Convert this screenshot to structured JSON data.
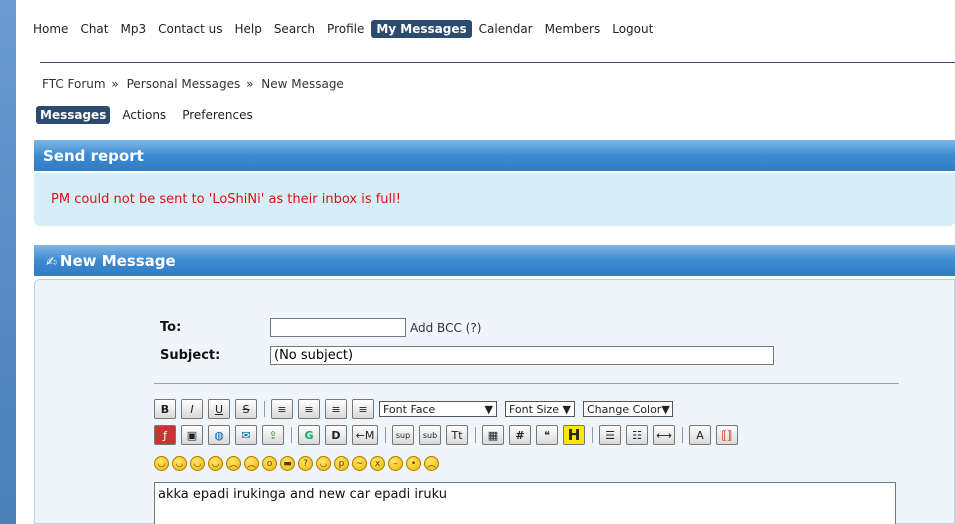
{
  "nav": [
    "Home",
    "Chat",
    "Mp3",
    "Contact us",
    "Help",
    "Search",
    "Profile",
    "My Messages",
    "Calendar",
    "Members",
    "Logout"
  ],
  "nav_active": "My Messages",
  "breadcrumb": [
    "FTC Forum",
    "Personal Messages",
    "New Message"
  ],
  "breadcrumb_sep": "»",
  "subtabs": [
    "Messages",
    "Actions",
    "Preferences"
  ],
  "send_report": {
    "title": "Send report",
    "message": "PM could not be sent to 'LoShiNi' as their inbox is full!"
  },
  "new_message": {
    "title": "New Message",
    "to_label": "To:",
    "to_value": "",
    "add_bcc": "Add BCC (?)",
    "subject_label": "Subject:",
    "subject_value": "(No subject)",
    "body": "akka epadi irukinga and new car epadi iruku"
  },
  "toolbar": {
    "font_face": "Font Face",
    "font_size": "Font Size",
    "change_color": "Change Color",
    "bold": "B",
    "italic": "I",
    "underline": "U",
    "strike": "S",
    "sup": "sup",
    "sub": "sub",
    "tt": "Tt",
    "hash": "#",
    "h": "H",
    "g": "G",
    "arrow": "←M"
  },
  "colors": {
    "nav_active": "#2a4a6e",
    "header_blue": "#3d8ad0",
    "report_bg": "#d7eef8",
    "error_red": "#d11111",
    "highlight_yellow": "#ffe600"
  }
}
